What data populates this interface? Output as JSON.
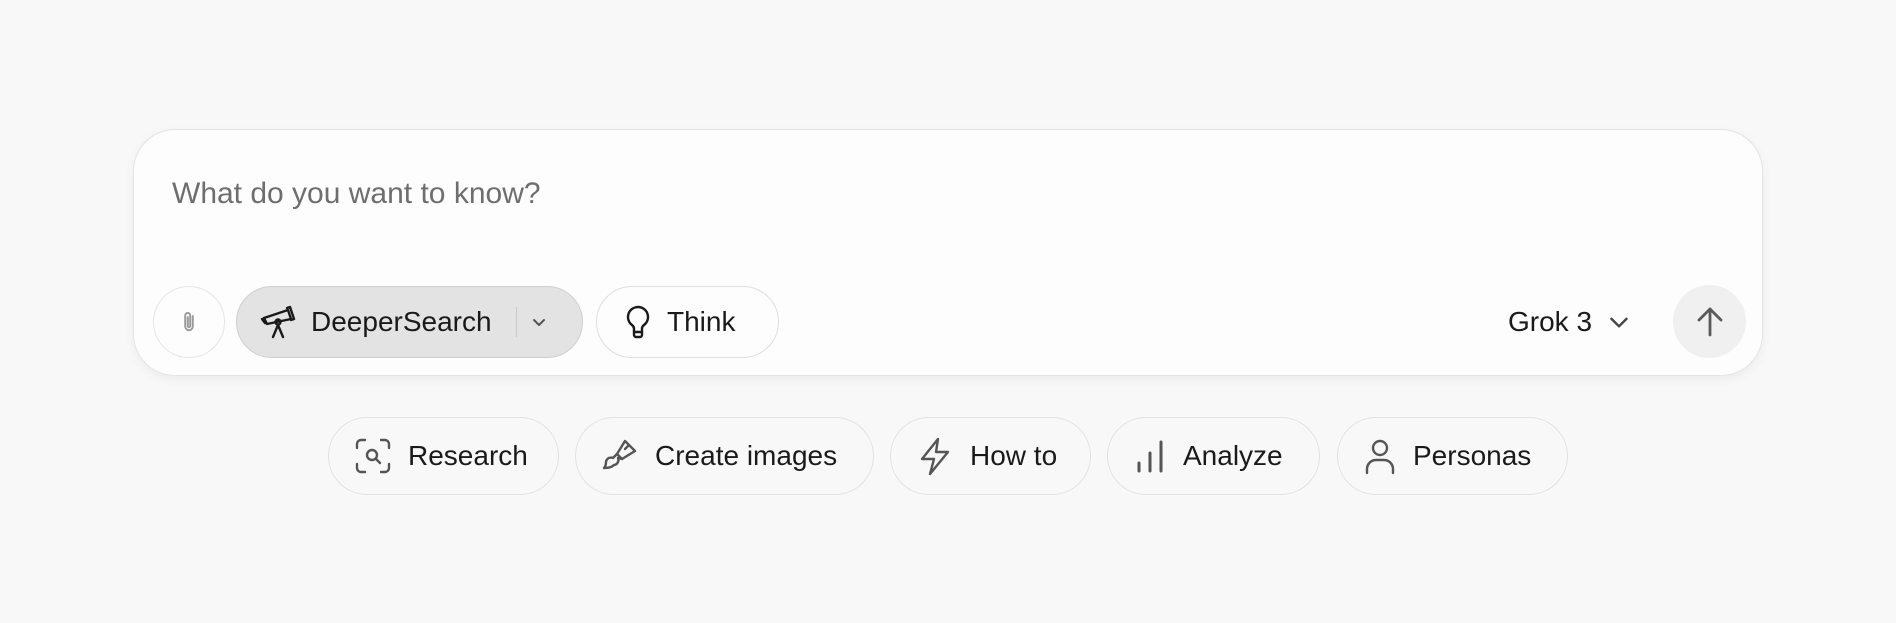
{
  "composer": {
    "placeholder": "What do you want to know?",
    "input_value": "",
    "deeper_search": {
      "label": "DeeperSearch",
      "icon": "telescope-icon",
      "active": true
    },
    "think": {
      "label": "Think",
      "icon": "lightbulb-icon"
    },
    "model": {
      "label": "Grok 3",
      "icon": "chevron-down-icon"
    },
    "attach": {
      "icon": "paperclip-icon"
    },
    "send": {
      "icon": "arrow-up-icon"
    }
  },
  "suggestions": [
    {
      "label": "Research",
      "icon": "scan-search-icon"
    },
    {
      "label": "Create images",
      "icon": "paintbrush-icon"
    },
    {
      "label": "How to",
      "icon": "lightning-icon"
    },
    {
      "label": "Analyze",
      "icon": "bar-chart-icon"
    },
    {
      "label": "Personas",
      "icon": "person-icon"
    }
  ],
  "colors": {
    "background": "#f8f8f8",
    "composer_bg": "#fdfdfd",
    "active_chip_bg": "#e3e3e3",
    "text": "#1a1a1a",
    "placeholder": "#6e6e6e"
  }
}
